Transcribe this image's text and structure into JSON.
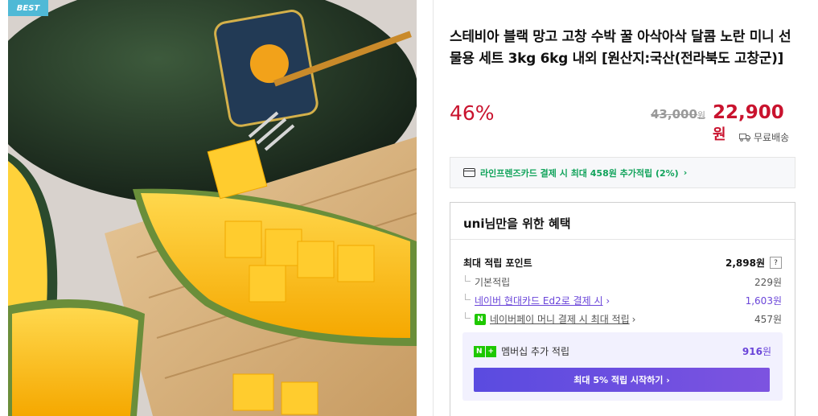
{
  "product": {
    "badge": "BEST",
    "image_label": "haemaru",
    "title": "스테비아 블랙 망고 고창 수박 꿀 아삭아삭 달콤 노란 미니 선물용 세트 3kg 6kg 내외 [원산지:국산(전라북도 고창군)]",
    "discount": "46%",
    "original_price": "43,000",
    "original_unit": "원",
    "sale_price": "22,900",
    "sale_unit": "원",
    "shipping": "무료배송"
  },
  "card_banner": {
    "text": "라인프렌즈카드 결제 시 최대 458원 추가적립 (2%)",
    "chevron": "›"
  },
  "benefits": {
    "heading": "uni님만을 위한 혜택",
    "max_points_label": "최대 적립 포인트",
    "max_points_value": "2,898원",
    "help": "?",
    "basic_label": "기본적립",
    "basic_value": "229원",
    "card_label": "네이버 현대카드 Ed2로 결제 시",
    "card_value": "1,603원",
    "npay_label": "네이버페이 머니 결제 시 최대 적립",
    "npay_value": "457원",
    "npay_icon": "N",
    "chevron": "›"
  },
  "membership": {
    "label": "멤버십 추가 적립",
    "value": "916",
    "unit": "원",
    "badge_n": "N",
    "badge_plus": "+",
    "cta": "최대 5% 적립 시작하기 ›"
  },
  "colors": {
    "accent_red": "#c9132e",
    "green": "#11a35b",
    "purple": "#6a45d9"
  }
}
